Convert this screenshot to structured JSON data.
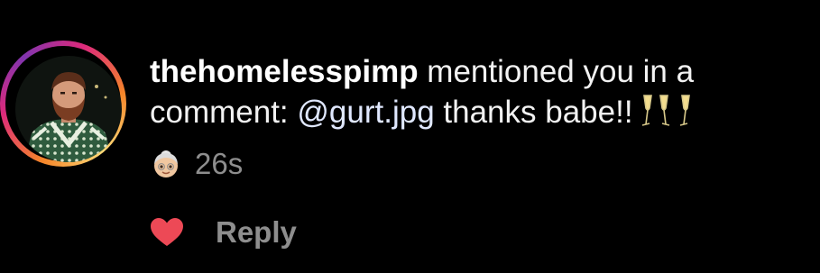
{
  "notification": {
    "username": "thehomelesspimp",
    "action_text": " mentioned you in a",
    "comment_prefix": "comment: ",
    "mention": "@gurt.jpg",
    "comment_text": " thanks babe!!",
    "trailing_emoji": [
      "champagne-glasses",
      "champagne-glasses"
    ],
    "avatar_emoji": "older-woman",
    "timestamp": "26s"
  },
  "actions": {
    "like_icon": "heart-icon",
    "reply_label": "Reply"
  },
  "colors": {
    "background": "#000000",
    "text": "#f2f2f2",
    "muted": "#8e8e8e",
    "mention": "#e0e8ff",
    "heart": "#ed4956"
  }
}
